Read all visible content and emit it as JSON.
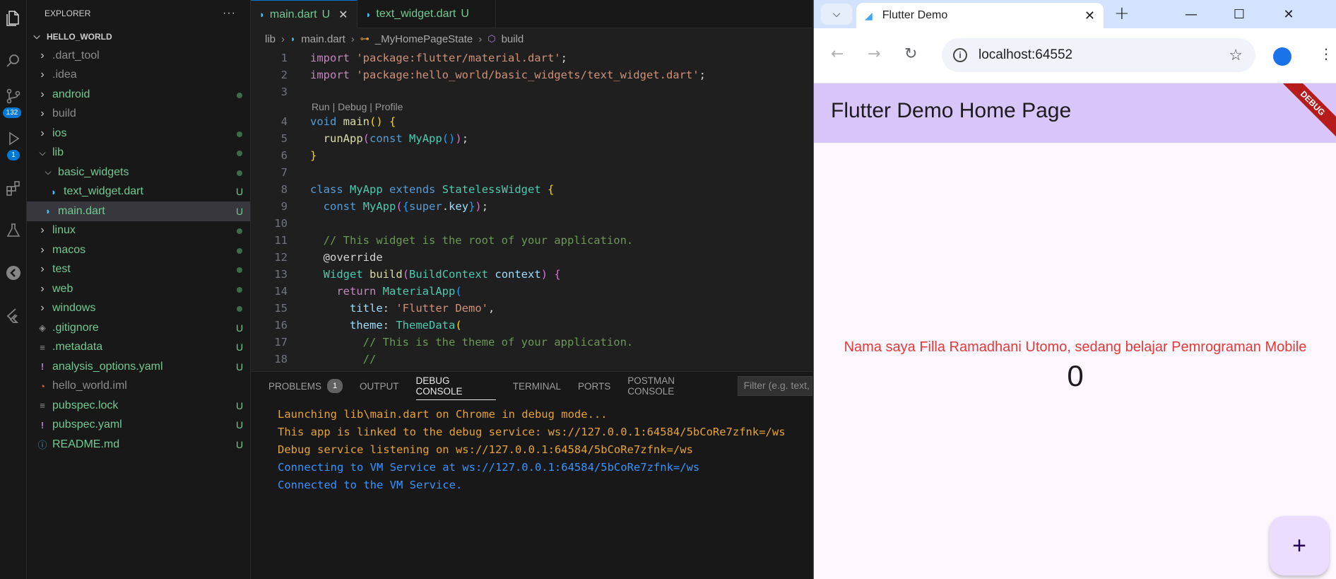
{
  "explorer": {
    "title": "EXPLORER",
    "more": "···",
    "root": "HELLO_WORLD",
    "items": [
      {
        "label": ".dart_tool",
        "kind": "folder",
        "open": false,
        "depth": 0,
        "color": "grey",
        "badge": ""
      },
      {
        "label": ".idea",
        "kind": "folder",
        "open": false,
        "depth": 0,
        "color": "grey",
        "badge": ""
      },
      {
        "label": "android",
        "kind": "folder",
        "open": false,
        "depth": 0,
        "color": "green",
        "badge": "dot"
      },
      {
        "label": "build",
        "kind": "folder",
        "open": false,
        "depth": 0,
        "color": "grey",
        "badge": ""
      },
      {
        "label": "ios",
        "kind": "folder",
        "open": false,
        "depth": 0,
        "color": "green",
        "badge": "dot"
      },
      {
        "label": "lib",
        "kind": "folder",
        "open": true,
        "depth": 0,
        "color": "green",
        "badge": "dot"
      },
      {
        "label": "basic_widgets",
        "kind": "folder",
        "open": true,
        "depth": 1,
        "color": "green",
        "badge": "dot"
      },
      {
        "label": "text_widget.dart",
        "kind": "dart",
        "depth": 2,
        "color": "green",
        "badge": "U"
      },
      {
        "label": "main.dart",
        "kind": "dart",
        "depth": 1,
        "color": "green",
        "badge": "U",
        "selected": true
      },
      {
        "label": "linux",
        "kind": "folder",
        "open": false,
        "depth": 0,
        "color": "green",
        "badge": "dot"
      },
      {
        "label": "macos",
        "kind": "folder",
        "open": false,
        "depth": 0,
        "color": "green",
        "badge": "dot"
      },
      {
        "label": "test",
        "kind": "folder",
        "open": false,
        "depth": 0,
        "color": "green",
        "badge": "dot"
      },
      {
        "label": "web",
        "kind": "folder",
        "open": false,
        "depth": 0,
        "color": "green",
        "badge": "dot"
      },
      {
        "label": "windows",
        "kind": "folder",
        "open": false,
        "depth": 0,
        "color": "green",
        "badge": "dot"
      },
      {
        "label": ".gitignore",
        "kind": "git",
        "depth": 0,
        "color": "green",
        "badge": "U"
      },
      {
        "label": ".metadata",
        "kind": "lines",
        "depth": 0,
        "color": "green",
        "badge": "U"
      },
      {
        "label": "analysis_options.yaml",
        "kind": "yaml",
        "depth": 0,
        "color": "green",
        "badge": "U"
      },
      {
        "label": "hello_world.iml",
        "kind": "rss",
        "depth": 0,
        "color": "grey",
        "badge": ""
      },
      {
        "label": "pubspec.lock",
        "kind": "lines",
        "depth": 0,
        "color": "green",
        "badge": "U"
      },
      {
        "label": "pubspec.yaml",
        "kind": "yaml",
        "depth": 0,
        "color": "green",
        "badge": "U"
      },
      {
        "label": "README.md",
        "kind": "info",
        "depth": 0,
        "color": "green",
        "badge": "U"
      }
    ]
  },
  "activity": {
    "scm_badge": "132",
    "debug_badge": "1"
  },
  "editor": {
    "tabs": [
      {
        "label": "main.dart",
        "mod": "U",
        "active": true
      },
      {
        "label": "text_widget.dart",
        "mod": "U",
        "active": false
      }
    ],
    "breadcrumb": [
      "lib",
      "main.dart",
      "_MyHomePageState",
      "build"
    ],
    "codelens": "Run | Debug | Profile"
  },
  "panel": {
    "tabs": [
      "PROBLEMS",
      "OUTPUT",
      "DEBUG CONSOLE",
      "TERMINAL",
      "PORTS",
      "POSTMAN CONSOLE"
    ],
    "problems_count": "1",
    "active_tab": "DEBUG CONSOLE",
    "filter_placeholder": "Filter (e.g. text, !exclude)",
    "logs": [
      {
        "text": "Launching lib\\main.dart on Chrome in debug mode...",
        "level": "warn"
      },
      {
        "text": "This app is linked to the debug service: ws://127.0.0.1:64584/5bCoRe7zfnk=/ws",
        "level": "warn"
      },
      {
        "text": "Debug service listening on ws://127.0.0.1:64584/5bCoRe7zfnk=/ws",
        "level": "warn"
      },
      {
        "text": "Connecting to VM Service at ws://127.0.0.1:64584/5bCoRe7zfnk=/ws",
        "level": "info"
      },
      {
        "text": "Connected to the VM Service.",
        "level": "info"
      }
    ]
  },
  "browser": {
    "tab_title": "Flutter Demo",
    "url": "localhost:64552",
    "appbar_title": "Flutter Demo Home Page",
    "debug_ribbon": "DEBUG",
    "body_text": "Nama saya Filla Ramadhani Utomo, sedang belajar Pemrograman Mobile",
    "counter": "0",
    "fab_label": "+"
  }
}
